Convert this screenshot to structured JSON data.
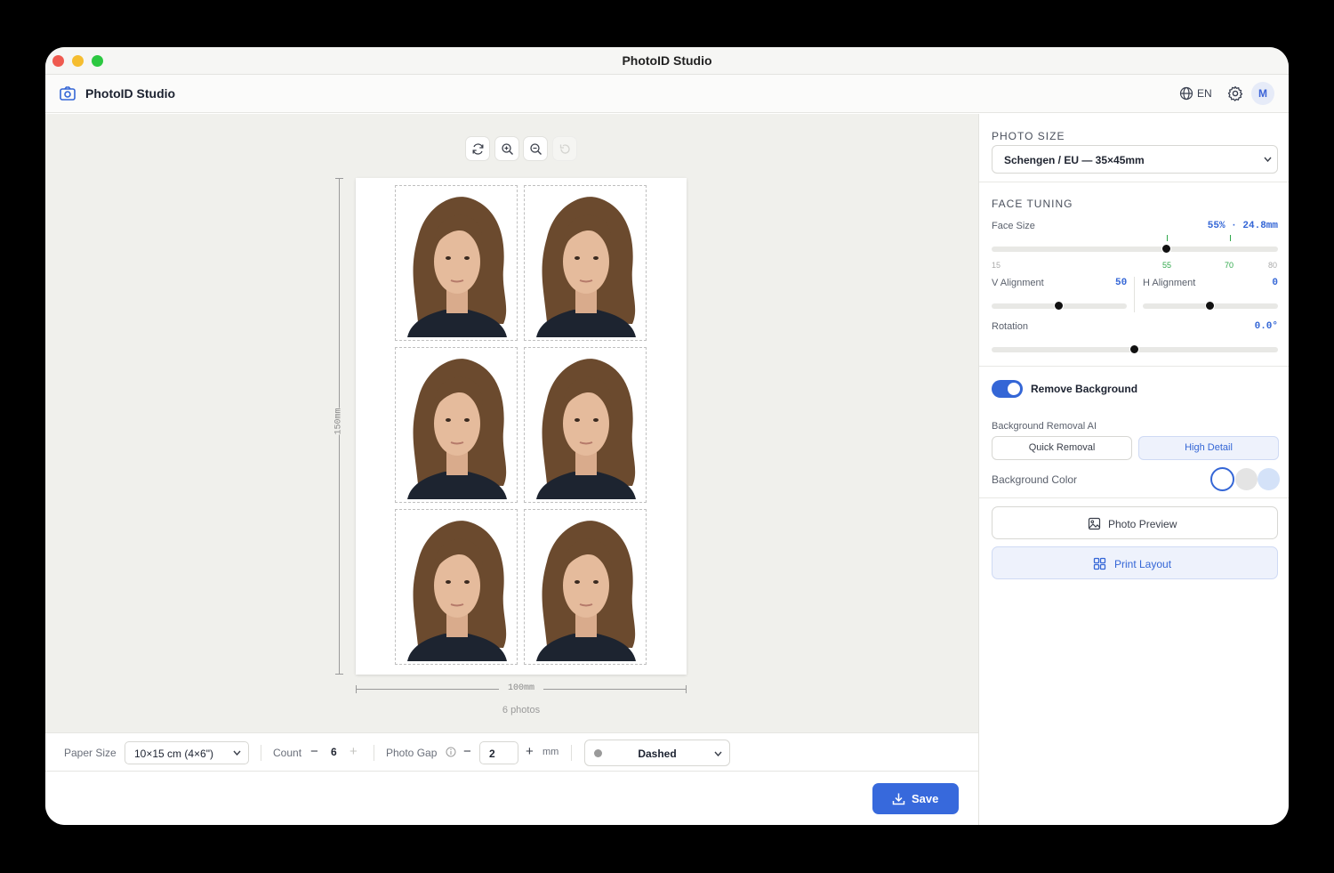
{
  "window": {
    "title": "PhotoID Studio"
  },
  "header": {
    "app_name": "PhotoID Studio",
    "language": "EN",
    "avatar_initial": "M"
  },
  "canvas": {
    "height_label": "150mm",
    "width_label": "100mm",
    "photo_count_label": "6 photos",
    "photos": 6
  },
  "bottom_bar": {
    "paper_size_label": "Paper Size",
    "paper_size_value": "10×15 cm (4×6\")",
    "count_label": "Count",
    "count_value": "6",
    "photo_gap_label": "Photo Gap",
    "photo_gap_value": "2",
    "gap_unit": "mm",
    "cut_line_style": "Dashed",
    "minus": "−",
    "plus": "+"
  },
  "footer": {
    "save_label": "Save"
  },
  "panel": {
    "photo_size_title": "PHOTO SIZE",
    "photo_size_value": "Schengen / EU — 35×45mm",
    "face_tuning_title": "FACE TUNING",
    "face_size_label": "Face Size",
    "face_size_value": "55% · 24.8mm",
    "face_size_percent": 55,
    "face_scale": {
      "min": "15",
      "low": "55",
      "high": "70",
      "max": "80"
    },
    "v_alignment_label": "V Alignment",
    "v_alignment_value": "50",
    "h_alignment_label": "H Alignment",
    "h_alignment_value": "0",
    "rotation_label": "Rotation",
    "rotation_value": "0.0°",
    "remove_bg_label": "Remove Background",
    "remove_bg_enabled": true,
    "bg_ai_label": "Background Removal AI",
    "bg_ai_options": [
      "Quick Removal",
      "High Detail"
    ],
    "bg_ai_selected": "High Detail",
    "bg_color_label": "Background Color",
    "bg_colors": [
      "#ffffff",
      "#e4e4e4",
      "#d4e2f8"
    ],
    "photo_preview_label": "Photo Preview",
    "print_layout_label": "Print Layout"
  },
  "colors": {
    "accent": "#3769dc",
    "green": "#2fa84a"
  }
}
